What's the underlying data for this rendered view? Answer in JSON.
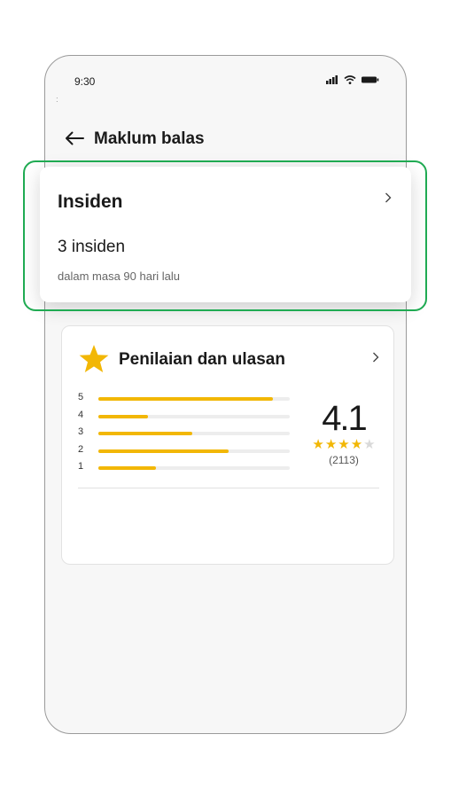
{
  "status_bar": {
    "time": "9:30",
    "signal_icon": "signal-icon",
    "wifi_icon": "wifi-icon",
    "battery_icon": "battery-icon"
  },
  "small_mark": "ː",
  "header": {
    "back_icon": "arrow-left-icon",
    "title": "Maklum balas"
  },
  "incident_card": {
    "title": "Insiden",
    "count_text": "3 insiden",
    "subtitle": "dalam masa 90 hari lalu",
    "chevron_icon": "chevron-right-icon"
  },
  "rating_card": {
    "title": "Penilaian dan ulasan",
    "star_icon": "star-icon",
    "chevron_icon": "chevron-right-icon",
    "bars": [
      {
        "label": "5",
        "fraction": 0.91
      },
      {
        "label": "4",
        "fraction": 0.26
      },
      {
        "label": "3",
        "fraction": 0.49
      },
      {
        "label": "2",
        "fraction": 0.68
      },
      {
        "label": "1",
        "fraction": 0.3
      }
    ],
    "score": "4.1",
    "star_rating": 4,
    "star_max": 5,
    "review_count": "(2113)"
  },
  "colors": {
    "accent_star": "#f2b705",
    "highlight_border": "#1faa52",
    "empty_star": "#d9d9d9"
  }
}
